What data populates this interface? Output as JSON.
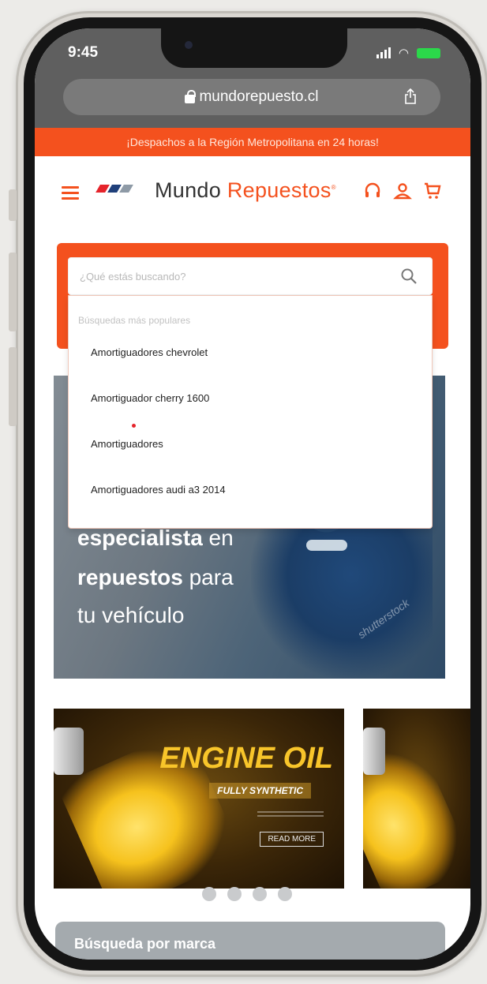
{
  "status_bar": {
    "time": "9:45"
  },
  "browser": {
    "url": "mundorepuesto.cl"
  },
  "promo": {
    "text": "¡Despachos a la Región Metropolitana en 24 horas!"
  },
  "header": {
    "logo_part1": "Mundo ",
    "logo_part2": "Repuestos",
    "logo_mark": "®"
  },
  "search": {
    "placeholder": "¿Qué estás buscando?",
    "popular_heading": "Búsquedas más populares",
    "suggestions": [
      "Amortiguadores chevrolet",
      "Amortiguador cherry 1600",
      "Amortiguadores",
      "Amortiguadores audi a3 2014"
    ]
  },
  "hero": {
    "line1_bold": "especialista",
    "line1_rest": " en",
    "line2_bold": "repuestos",
    "line2_rest": " para",
    "line3": "tu vehículo",
    "watermark": "shutterstock"
  },
  "banner": {
    "title": "ENGINE OIL",
    "subtitle": "FULLY SYNTHETIC",
    "button": "READ MORE"
  },
  "carousel": {
    "dot_count": 4
  },
  "brands": {
    "title": "Búsqueda por marca"
  },
  "colors": {
    "accent": "#f4511e",
    "browser_chrome": "#5f5f5f",
    "logo_red": "#e5242b",
    "logo_blue": "#1f3f7a",
    "logo_gray": "#8e9aa6"
  }
}
